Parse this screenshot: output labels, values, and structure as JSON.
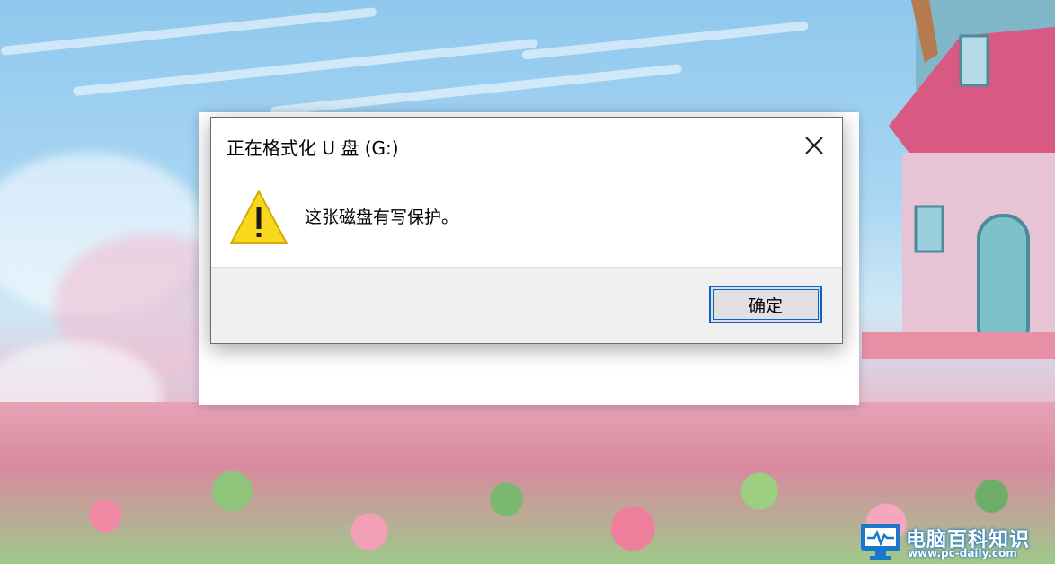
{
  "dialog": {
    "title": "正在格式化 U 盘 (G:)",
    "close_icon": "close-icon",
    "warning_icon": "warning-triangle-icon",
    "message": "这张磁盘有写保护。",
    "ok_label": "确定"
  },
  "watermark": {
    "name": "电脑百科知识",
    "url": "www.pc-daily.com",
    "brand_color": "#1b78c8"
  },
  "colors": {
    "button_focus_border": "#0a64c4",
    "warning_yellow": "#f9d71c",
    "footer_bg": "#f0f0f0"
  }
}
